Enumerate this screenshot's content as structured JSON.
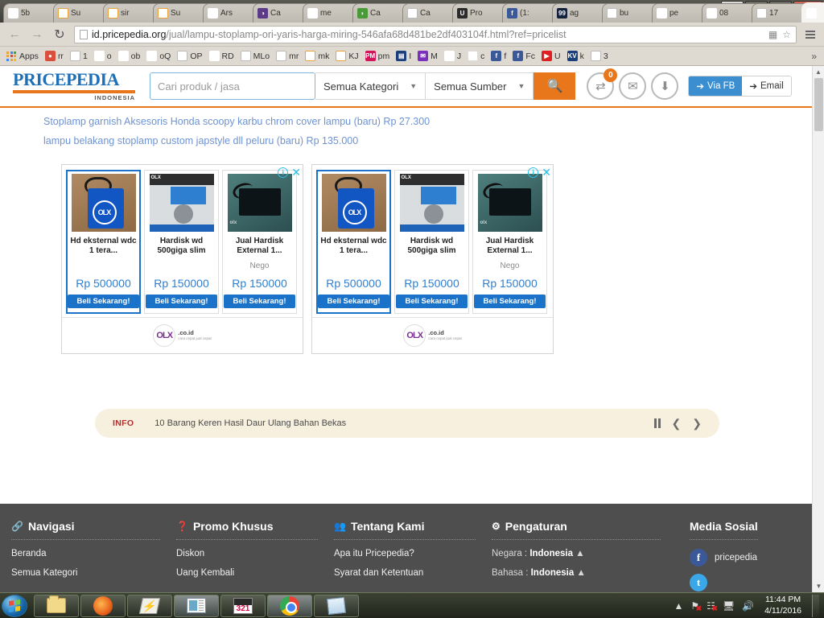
{
  "browser": {
    "tabs": [
      {
        "label": "5b",
        "icon": "google-icon",
        "active": false
      },
      {
        "label": "Su",
        "icon": "kaskus-icon",
        "active": false
      },
      {
        "label": "sir",
        "icon": "kaskus-icon",
        "active": false
      },
      {
        "label": "Su",
        "icon": "kaskus-icon",
        "active": false
      },
      {
        "label": "Ars",
        "icon": "olx-icon",
        "active": false
      },
      {
        "label": "Ca",
        "icon": "protect-icon",
        "active": false
      },
      {
        "label": "me",
        "icon": "google-icon",
        "active": false
      },
      {
        "label": "Ca",
        "icon": "leaf-icon",
        "active": false
      },
      {
        "label": "Ca",
        "icon": "document-icon",
        "active": false
      },
      {
        "label": "Pro",
        "icon": "shield-icon",
        "active": false
      },
      {
        "label": "(1:",
        "icon": "facebook-icon",
        "active": false
      },
      {
        "label": "ag",
        "icon": "99-icon",
        "active": false
      },
      {
        "label": "bu",
        "icon": "document-icon",
        "active": false
      },
      {
        "label": "pe",
        "icon": "google-icon",
        "active": false
      },
      {
        "label": "08",
        "icon": "google-icon",
        "active": false
      },
      {
        "label": "17",
        "icon": "document-icon",
        "active": false
      },
      {
        "label": "",
        "icon": "pricepedia-icon",
        "active": true
      }
    ],
    "tab_close_label": "×",
    "window_controls": {
      "minimize": "–",
      "maximize": "❐",
      "close": "✕",
      "user": "▲"
    },
    "nav": {
      "back": "←",
      "forward": "→",
      "reload": "↻"
    },
    "url_host": "id.pricepedia.org",
    "url_path": "/jual/lampu-stoplamp-ori-yaris-harga-miring-546afa68d481be2df403104f.html?ref=pricelist",
    "omni_translate_icon": "translate-icon",
    "omni_star_icon": "star-icon",
    "bookmarks": [
      {
        "label": "Apps",
        "icon": "apps-grid-icon"
      },
      {
        "label": "rr",
        "icon": "orange-circle-icon"
      },
      {
        "label": "1",
        "icon": "document-icon"
      },
      {
        "label": "o",
        "icon": "olx-icon"
      },
      {
        "label": "ob",
        "icon": "olx-icon"
      },
      {
        "label": "oQ",
        "icon": "olx-icon"
      },
      {
        "label": "OP",
        "icon": "document-icon"
      },
      {
        "label": "RD",
        "icon": "olx-icon"
      },
      {
        "label": "MLo",
        "icon": "document-icon"
      },
      {
        "label": "mr",
        "icon": "document-icon"
      },
      {
        "label": "mk",
        "icon": "kaskus-icon"
      },
      {
        "label": "KJ",
        "icon": "kaskus-icon"
      },
      {
        "label": "pm",
        "icon": "pm-icon"
      },
      {
        "label": "I",
        "icon": "image-icon"
      },
      {
        "label": "M",
        "icon": "mail-icon"
      },
      {
        "label": "J",
        "icon": "jne-icon"
      },
      {
        "label": "c",
        "icon": "colorful-icon"
      },
      {
        "label": "f",
        "icon": "facebook-icon"
      },
      {
        "label": "Fc",
        "icon": "facebook-icon"
      },
      {
        "label": "U",
        "icon": "youtube-icon"
      },
      {
        "label": "k",
        "icon": "kv-icon"
      },
      {
        "label": "3",
        "icon": "document-icon"
      }
    ],
    "bookmarks_overflow": "»",
    "menu_icon": "hamburger-menu-icon"
  },
  "site": {
    "logo": {
      "name": "PRICEPEDIA",
      "sub": "INDONESIA"
    },
    "search": {
      "placeholder": "Cari produk / jasa",
      "value": "",
      "category": "Semua Kategori",
      "source": "Semua Sumber",
      "button_icon": "search-icon"
    },
    "actions": {
      "compare_icon": "compare-icon",
      "compare_badge": "0",
      "mail_icon": "envelope-icon",
      "download_icon": "download-circle-icon"
    },
    "auth": {
      "fb": "Via FB",
      "email": "Email",
      "fb_icon": "login-icon",
      "email_icon": "login-icon"
    },
    "product_links": [
      "Stoplamp garnish Aksesoris Honda scoopy karbu chrom cover lampu (baru) Rp 27.300",
      "lampu belakang stoplamp custom japstyle dll peluru (baru) Rp 135.000"
    ]
  },
  "ads": {
    "info_icon": "info-icon",
    "close_icon": "close-icon",
    "provider": {
      "name": "OLX",
      "domain": ".co.id",
      "tagline": "cara cepat jual cepat"
    },
    "buy_label": "Beli Sekarang!",
    "blocks": [
      {
        "cards": [
          {
            "title": "Hd eksternal wdc 1 tera...",
            "price": "Rp 500000",
            "nego": "",
            "selected": true,
            "photo": "ph1"
          },
          {
            "title": "Hardisk wd 500giga slim",
            "price": "Rp 150000",
            "nego": "",
            "selected": false,
            "photo": "ph2"
          },
          {
            "title": "Jual Hardisk External 1...",
            "price": "Rp 150000",
            "nego": "Nego",
            "selected": false,
            "photo": "ph3"
          }
        ]
      },
      {
        "cards": [
          {
            "title": "Hd eksternal wdc 1 tera...",
            "price": "Rp 500000",
            "nego": "",
            "selected": true,
            "photo": "ph1"
          },
          {
            "title": "Hardisk wd 500giga slim",
            "price": "Rp 150000",
            "nego": "",
            "selected": false,
            "photo": "ph2"
          },
          {
            "title": "Jual Hardisk External 1...",
            "price": "Rp 150000",
            "nego": "Nego",
            "selected": false,
            "photo": "ph3"
          }
        ]
      }
    ]
  },
  "infobar": {
    "label": "INFO",
    "text": "10 Barang Keren Hasil Daur Ulang Bahan Bekas",
    "pause_icon": "pause-icon",
    "prev_icon": "chevron-left-icon",
    "next_icon": "chevron-right-icon"
  },
  "footer": {
    "columns": [
      {
        "icon": "link-icon",
        "title": "Navigasi",
        "links": [
          "Beranda",
          "Semua Kategori"
        ]
      },
      {
        "icon": "question-icon",
        "title": "Promo Khusus",
        "links": [
          "Diskon",
          "Uang Kembali"
        ]
      },
      {
        "icon": "people-icon",
        "title": "Tentang Kami",
        "links": [
          "Apa itu Pricepedia?",
          "Syarat dan Ketentuan"
        ]
      }
    ],
    "settings": {
      "icon": "gear-icon",
      "title": "Pengaturan",
      "rows": [
        {
          "label": "Negara :",
          "value": "Indonesia",
          "caret": "▲"
        },
        {
          "label": "Bahasa :",
          "value": "Indonesia",
          "caret": "▲"
        }
      ]
    },
    "social": {
      "title": "Media Sosial",
      "items": [
        {
          "name": "pricepedia",
          "icon": "facebook-icon",
          "color": "#3b5998"
        },
        {
          "name": "",
          "icon": "twitter-icon",
          "color": "#3aa8e8"
        }
      ]
    }
  },
  "scrollbar": {
    "up": "▲",
    "down": "▼"
  },
  "taskbar": {
    "start_icon": "windows-start-icon",
    "items": [
      {
        "icon": "folder-icon",
        "name": "file-explorer"
      },
      {
        "icon": "firefox-icon",
        "name": "firefox"
      },
      {
        "icon": "winamp-icon",
        "name": "winamp"
      },
      {
        "icon": "media-window-icon",
        "name": "media-player"
      },
      {
        "icon": "kmplayer-icon",
        "name": "kmplayer"
      },
      {
        "icon": "chrome-icon",
        "name": "chrome"
      },
      {
        "icon": "notepad-icon",
        "name": "notepad"
      }
    ],
    "tray": {
      "expand": "▲",
      "icons": [
        "flag-error-icon",
        "network-error-icon",
        "usb-icon",
        "volume-icon"
      ],
      "time": "11:44 PM",
      "date": "4/11/2016"
    }
  }
}
